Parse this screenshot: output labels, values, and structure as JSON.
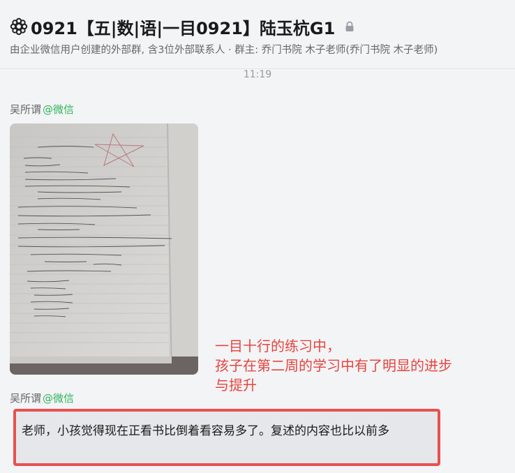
{
  "header": {
    "title": "0921【五|数|语|一目0921】陆玉杭G1",
    "group_icon": "flower-gear-icon",
    "lock_icon": "lock-icon",
    "subtitle": "由企业微信用户创建的外部群, 含3位外部联系人 · 群主: 乔门书院 木子老师(乔门书院 木子老师)"
  },
  "timestamp": "11:19",
  "messages": [
    {
      "sender": "吴所谓",
      "source": "@微信",
      "type": "image",
      "image_desc": "notebook-photo"
    },
    {
      "sender": "吴所谓",
      "source": "@微信",
      "type": "text",
      "text": "老师，小孩觉得现在正看书比倒着看容易多了。复述的内容也比以前多"
    }
  ],
  "annotation": {
    "lines": [
      "一目十行的练习中，",
      "孩子在第二周的学习中有了明显的进步",
      "与提升"
    ],
    "color": "#e8443e"
  },
  "colors": {
    "highlight_border": "#e95050",
    "source_green": "#2fb55a"
  }
}
